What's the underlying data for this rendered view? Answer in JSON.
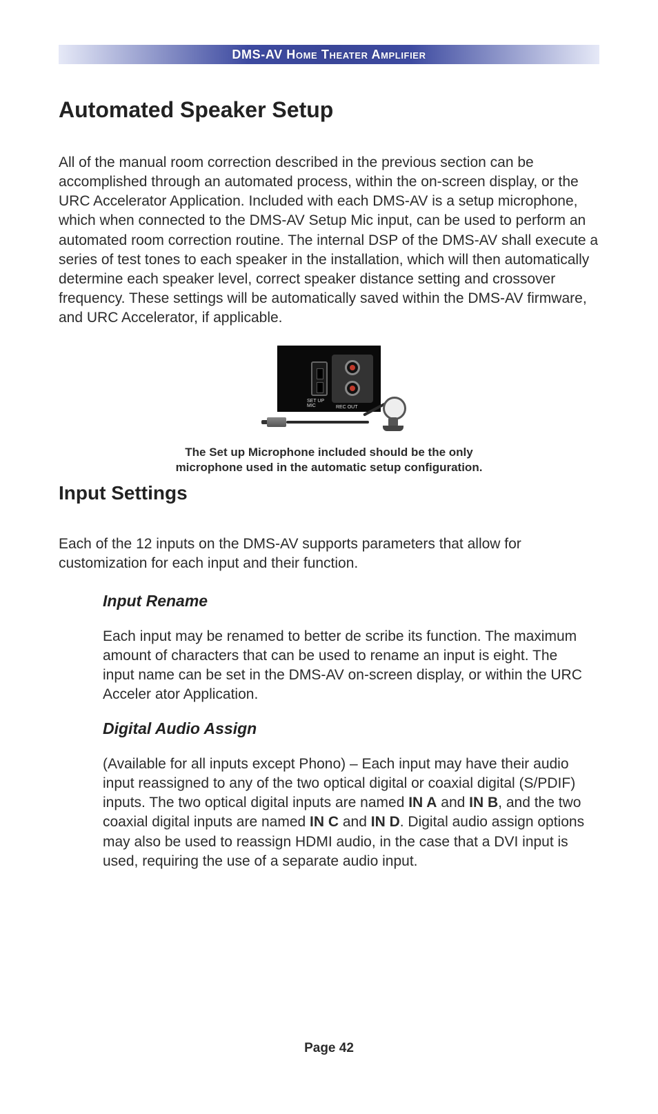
{
  "header": "DMS-AV Home Theater Amplifier",
  "h1": "Automated Speaker Setup",
  "para1": "All of the manual room correction described in the previous section can be accomplished through an automated process, within the on-screen display, or the URC Accelerator Application.  Included with each DMS-AV is a setup microphone, which when connected to the DMS-AV Setup Mic input, can be used to perform an automated room correction routine.  The internal DSP of the DMS-AV shall execute a series of test tones to each speaker in the installation, which will then automatically determine each speaker level, correct speaker distance setting and crossover frequency. These settings will be automatically saved within the DMS-AV firmware, and URC Accelerator, if applicable.",
  "caption_line1": "The Set up Microphone included should be the only",
  "caption_line2": "microphone used in the automatic setup configuration.",
  "h2": "Input Settings",
  "para2": "Each of the 12 inputs on the DMS-AV supports parameters that allow for customization for each input and their function.",
  "sub1_title": "Input Rename",
  "sub1_body": "Each input may be renamed to better de scribe its function. The maximum amount of characters that can be used to rename an input is eight. The  input name can be set in the DMS-AV on-screen display, or within  the URC Acceler ator Application.",
  "sub2_title": "Digital Audio Assign",
  "sub2_pre": "(Available for all inputs except Phono) – Each input may have their audio input reassigned to any of the two optical digital or coaxial digital (S/PDIF) inputs. The two optical digital inputs are named ",
  "in_a": "IN A",
  "sub2_mid1": "  and ",
  "in_b": "IN B",
  "sub2_mid2": ", and the two coaxial digital inputs are named ",
  "in_c": "IN C",
  "sub2_mid3": " and ",
  "in_d": "IN D",
  "sub2_post": ". Digital audio assign options may also be used to reassign HDMI audio, in the case that a DVI input is used, requiring the use of a separate audio input.",
  "page_num": "Page 42",
  "fig_labels": {
    "setup": "SET UP",
    "mic": "MIC",
    "rec": "REC OUT"
  }
}
